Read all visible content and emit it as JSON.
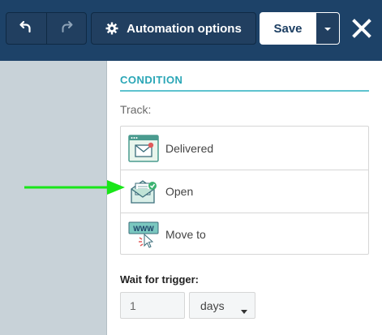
{
  "toolbar": {
    "undo_icon": "undo-icon",
    "redo_icon": "redo-icon",
    "automation_label": "Automation options",
    "automation_icon": "gear-icon",
    "save_label": "Save",
    "close_icon": "close-icon"
  },
  "condition": {
    "title": "CONDITION",
    "track_label": "Track:",
    "items": [
      {
        "label": "Delivered",
        "icon": "envelope-delivered-icon"
      },
      {
        "label": "Open",
        "icon": "envelope-open-icon"
      },
      {
        "label": "Move to",
        "icon": "www-cursor-icon"
      }
    ]
  },
  "wait": {
    "label": "Wait for trigger:",
    "value": "1",
    "unit": "days"
  },
  "colors": {
    "toolbar_bg": "#1d4268",
    "accent_teal": "#2aa6b6",
    "annotation_arrow": "#19e619"
  }
}
